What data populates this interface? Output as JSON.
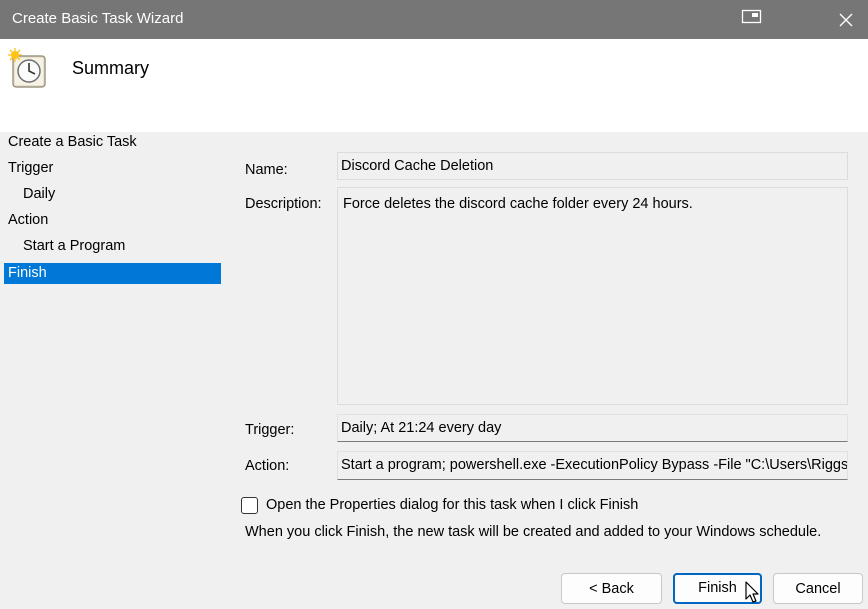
{
  "window": {
    "title": "Create Basic Task Wizard"
  },
  "header": {
    "heading": "Summary",
    "icon": "scheduled-task-clock-icon"
  },
  "sidebar": {
    "items": [
      {
        "label": "Create a Basic Task",
        "selected": false
      },
      {
        "label": "Trigger",
        "selected": false
      },
      {
        "label": "Daily",
        "selected": false
      },
      {
        "label": "Action",
        "selected": false
      },
      {
        "label": "Start a Program",
        "selected": false
      },
      {
        "label": "Finish",
        "selected": true
      }
    ]
  },
  "summary": {
    "name_label": "Name:",
    "name_value": "Discord Cache Deletion",
    "description_label": "Description:",
    "description_value": "Force deletes the discord cache folder every 24 hours.",
    "trigger_label": "Trigger:",
    "trigger_value": "Daily; At 21:24 every day",
    "action_label": "Action:",
    "action_value": "Start a program; powershell.exe -ExecutionPolicy Bypass -File \"C:\\Users\\Riggs\\D"
  },
  "options": {
    "open_properties_label": "Open the Properties dialog for this task when I click Finish",
    "open_properties_checked": false,
    "info_text": "When you click Finish, the new task will be created and added to your Windows schedule."
  },
  "buttons": {
    "back": "< Back",
    "finish": "Finish",
    "cancel": "Cancel"
  },
  "colors": {
    "titlebar": "#767676",
    "selection": "#0078d7",
    "primary_border": "#0067c0"
  }
}
